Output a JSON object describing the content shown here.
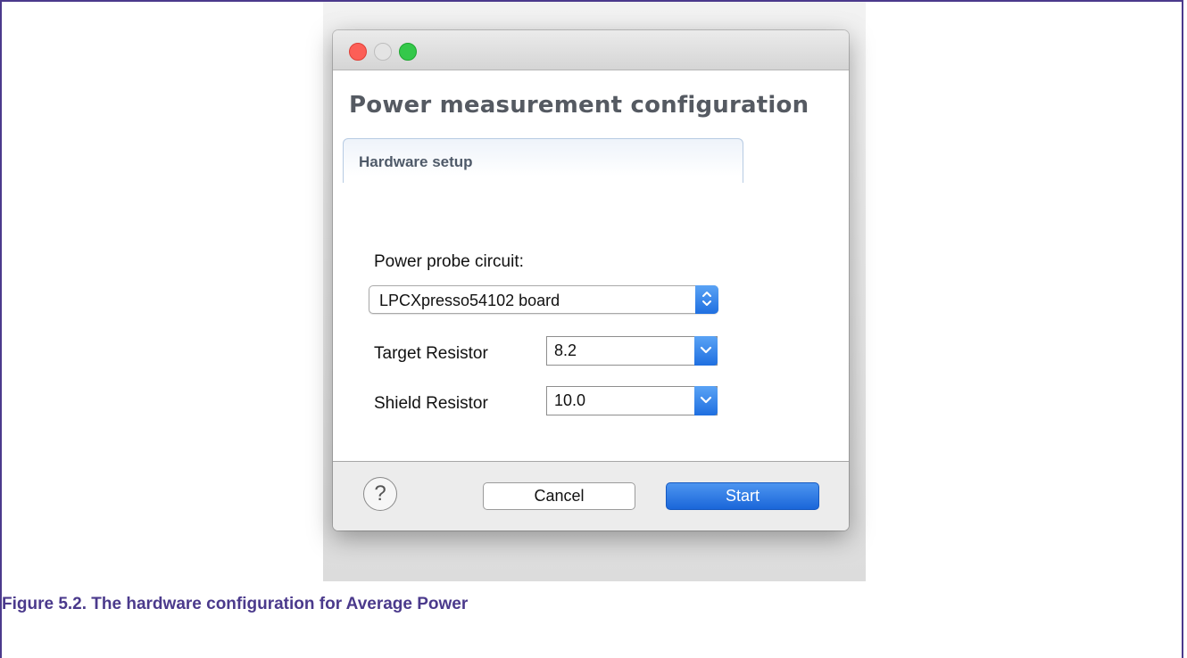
{
  "caption": "Figure 5.2. The hardware configuration for Average Power",
  "dialog": {
    "title": "Power measurement configuration",
    "tab_label": "Hardware setup",
    "probe_label": "Power probe circuit:",
    "probe_value": "LPCXpresso54102 board",
    "target_label": "Target Resistor",
    "target_value": "8.2",
    "shield_label": "Shield Resistor",
    "shield_value": "10.0",
    "help_glyph": "?",
    "cancel_label": "Cancel",
    "start_label": "Start"
  },
  "colors": {
    "frame": "#4b3a8c",
    "accent_blue": "#1f6fe0",
    "close": "#fc5f57",
    "zoom": "#34c84a"
  },
  "icons": [
    "close-icon",
    "minimize-icon",
    "zoom-icon",
    "help-icon",
    "updown-chevron-icon",
    "chevron-down-icon"
  ]
}
